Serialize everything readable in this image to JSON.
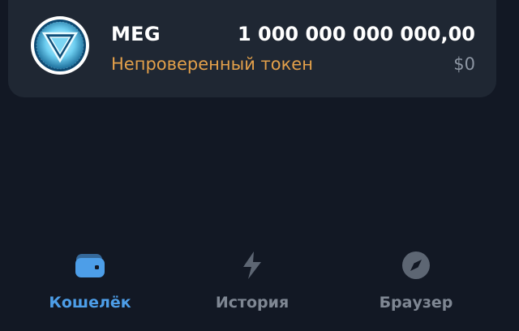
{
  "token": {
    "symbol": "MEG",
    "status": "Непроверенный токен",
    "balance": "1 000 000 000 000,00",
    "fiat_value": "$0"
  },
  "colors": {
    "background": "#121824",
    "card": "#1f2733",
    "warning": "#e3a04a",
    "accent": "#4d9ee8",
    "muted": "#7f8793"
  },
  "tabs": [
    {
      "label": "Кошелёк",
      "icon": "wallet-icon",
      "active": true
    },
    {
      "label": "История",
      "icon": "lightning-icon",
      "active": false
    },
    {
      "label": "Браузер",
      "icon": "compass-icon",
      "active": false
    }
  ]
}
